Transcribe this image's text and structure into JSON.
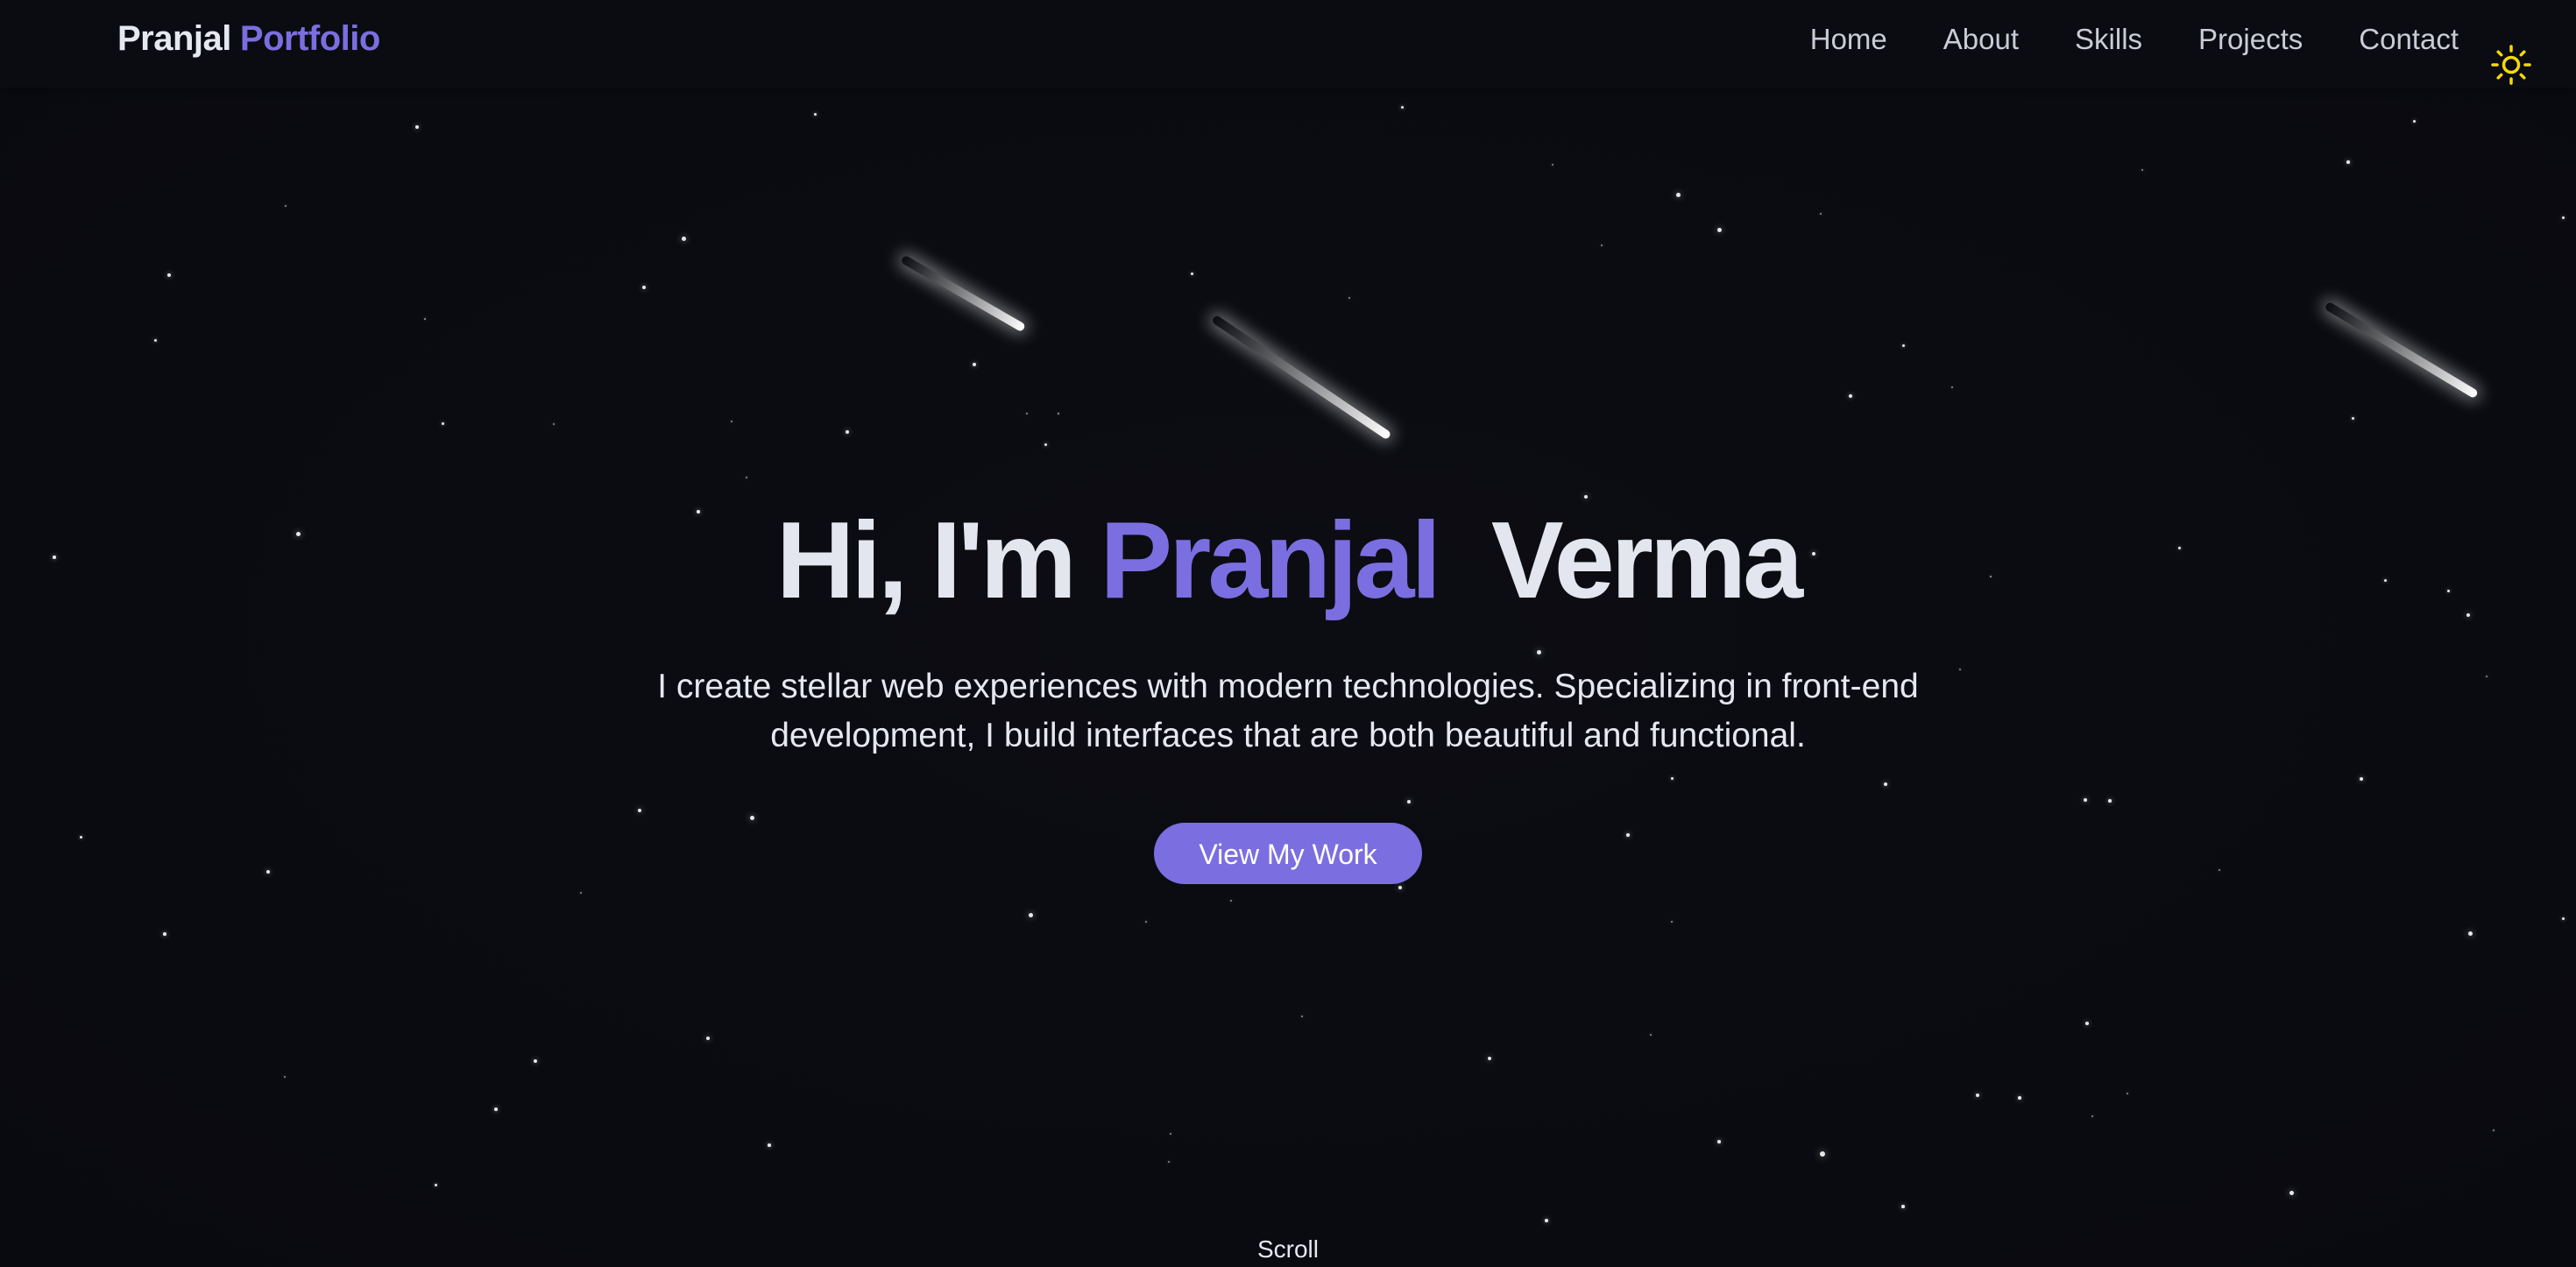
{
  "navbar": {
    "brand_first": "Pranjal",
    "brand_second": "Portfolio",
    "links": [
      "Home",
      "About",
      "Skills",
      "Projects",
      "Contact"
    ],
    "theme_toggle_icon": "sun-icon"
  },
  "hero": {
    "title_prefix": "Hi, I'm",
    "title_accent": "Pranjal",
    "title_suffix": "Verma",
    "subtitle": "I create stellar web experiences with modern technologies. Specializing in front-end development, I build interfaces that are both beautiful and functional.",
    "cta_label": "View My Work",
    "scroll_label": "Scroll"
  },
  "colors": {
    "background": "#0a0b10",
    "accent": "#7b6ee0",
    "text": "#e3e6ee",
    "sun": "#f5d90a"
  }
}
